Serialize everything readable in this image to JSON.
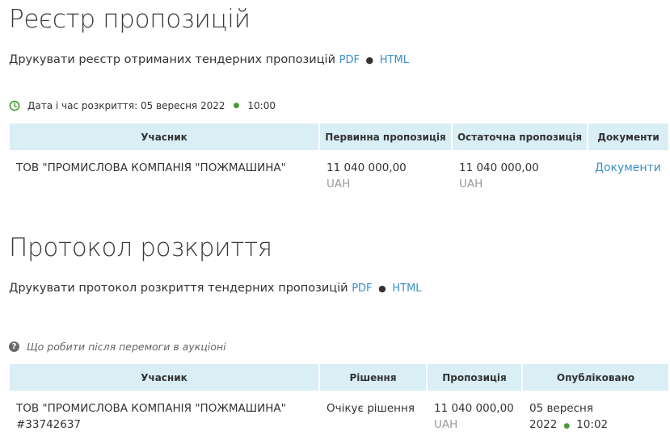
{
  "registry": {
    "title": "Реєстр пропозицій",
    "print_text": "Друкувати реєстр отриманих тендерних пропозицій",
    "pdf_label": "PDF",
    "separator": "●",
    "html_label": "HTML",
    "opening_label": "Дата і час розкриття: 05 вересня 2022",
    "opening_time": "10:00",
    "columns": [
      "Учасник",
      "Первинна пропозиція",
      "Остаточна пропозиція",
      "Документи"
    ],
    "row": {
      "participant": "ТОВ \"ПРОМИСЛОВА КОМПАНІЯ \"ПОЖМАШИНА\"",
      "initial_amount": "11 040 000,00",
      "initial_currency": "UAH",
      "final_amount": "11 040 000,00",
      "final_currency": "UAH",
      "documents_link": "Документи"
    }
  },
  "protocol": {
    "title": "Протокол розкриття",
    "print_text": "Друкувати протокол розкриття тендерних пропозицій",
    "pdf_label": "PDF",
    "separator": "●",
    "html_label": "HTML",
    "help_link": "Що робити після перемоги в аукціоні",
    "columns": [
      "Учасник",
      "Рішення",
      "Пропозиція",
      "Опубліковано"
    ],
    "row": {
      "participant": "ТОВ \"ПРОМИСЛОВА КОМПАНІЯ \"ПОЖМАШИНА\"",
      "participant_id": "#33742637",
      "decision": "Очікує рішення",
      "amount": "11 040 000,00",
      "currency": "UAH",
      "published_date": "05 вересня 2022",
      "published_time": "10:02"
    }
  },
  "colors": {
    "header_bg": "#d9eef5",
    "link": "#3a8fc7",
    "clock_icon": "#4a9a3a",
    "muted": "#9a9a9a"
  },
  "icons": {
    "clock": "clock-icon",
    "help": "question-circle-icon",
    "dot": "bullet-dot"
  }
}
